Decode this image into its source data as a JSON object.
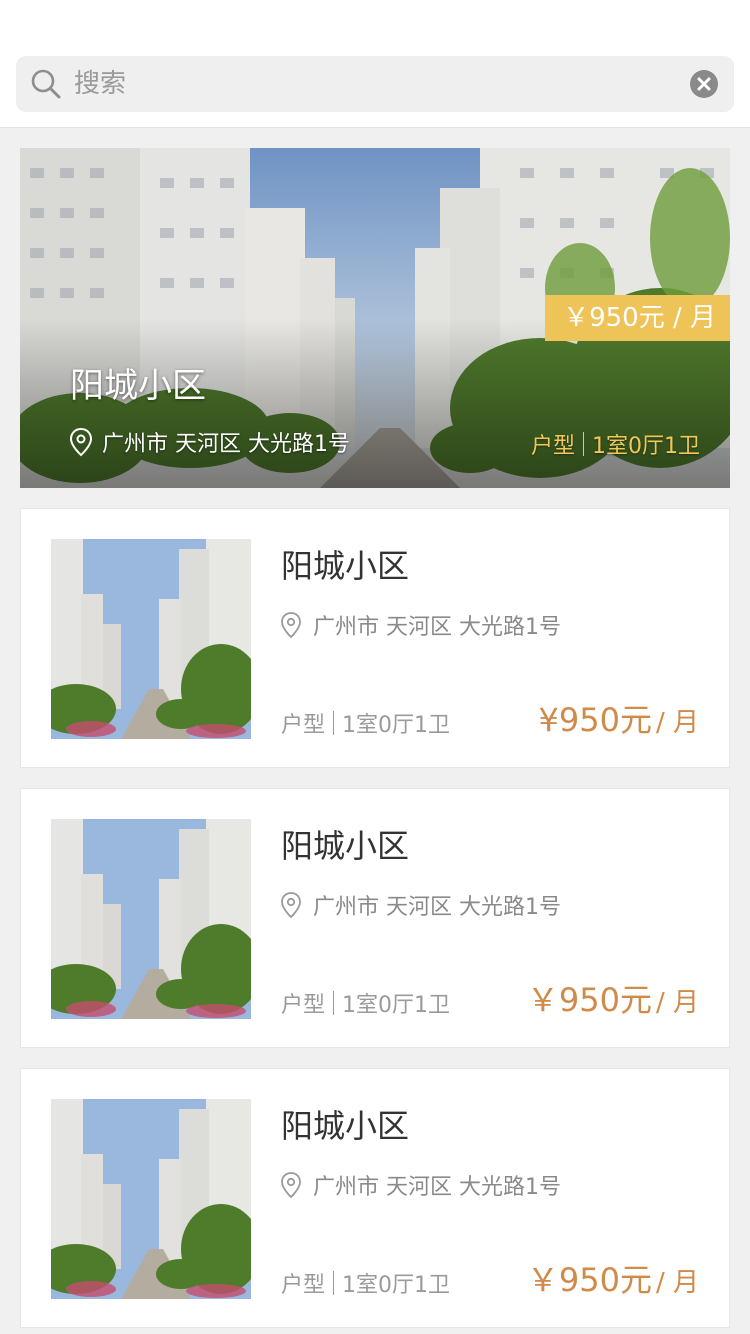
{
  "search": {
    "placeholder": "搜索"
  },
  "featured": {
    "title": "阳城小区",
    "address": "广州市 天河区 大光路1号",
    "price": "￥950元 / 月",
    "layout_label": "户型",
    "layout_value": "1室0厅1卫"
  },
  "listings": [
    {
      "title": "阳城小区",
      "address": "广州市 天河区 大光路1号",
      "layout_label": "户型",
      "layout_value": "1室0厅1卫",
      "price": "¥950元",
      "price_unit": "/ 月"
    },
    {
      "title": "阳城小区",
      "address": "广州市 天河区 大光路1号",
      "layout_label": "户型",
      "layout_value": "1室0厅1卫",
      "price": "￥950元",
      "price_unit": "/ 月"
    },
    {
      "title": "阳城小区",
      "address": "广州市 天河区 大光路1号",
      "layout_label": "户型",
      "layout_value": "1室0厅1卫",
      "price": "￥950元",
      "price_unit": "/ 月"
    }
  ],
  "colors": {
    "accent_price": "#d08a4a",
    "badge_yellow": "#eec357",
    "background": "#f0f0f0"
  }
}
